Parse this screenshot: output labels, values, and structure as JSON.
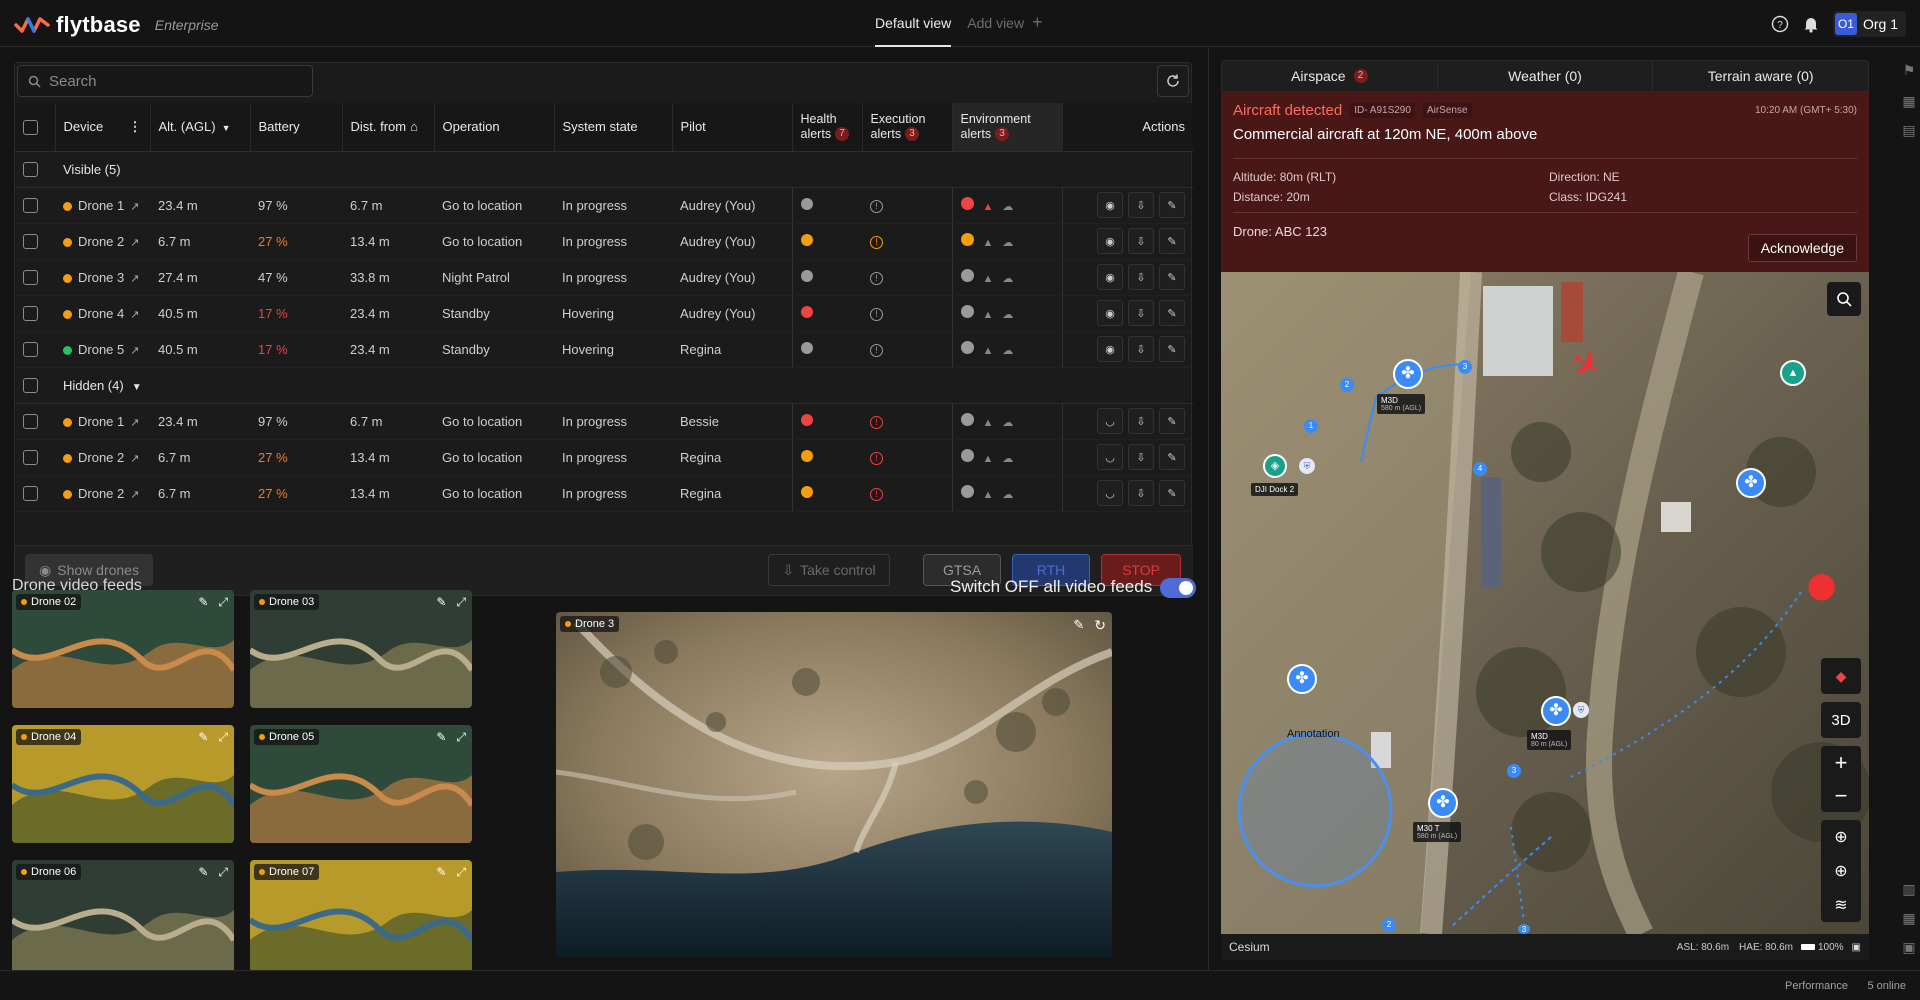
{
  "app": {
    "brand": "flytbase",
    "edition": "Enterprise"
  },
  "views": {
    "active": "Default view",
    "add": "Add view"
  },
  "org": {
    "badge": "O1",
    "name": "Org 1"
  },
  "table": {
    "search_placeholder": "Search",
    "columns": {
      "device": "Device",
      "alt": "Alt. (AGL)",
      "battery": "Battery",
      "dist": "Dist. from",
      "operation": "Operation",
      "system_state": "System state",
      "pilot": "Pilot",
      "health": "Health alerts",
      "health_count": "7",
      "execution": "Execution alerts",
      "execution_count": "3",
      "environment": "Environment alerts",
      "environment_count": "3",
      "actions": "Actions"
    },
    "visible_group": "Visible (5)",
    "hidden_group": "Hidden (4)",
    "visible_rows": [
      {
        "device": "Drone 1",
        "status": "warn",
        "alt": "23.4 m",
        "battery": "97 %",
        "battery_level": "ok",
        "dist": "6.7 m",
        "operation": "Go to location",
        "state": "In progress",
        "pilot": "Audrey (You)",
        "health": "normal",
        "exec": "normal",
        "env": "alert"
      },
      {
        "device": "Drone 2",
        "status": "warn",
        "alt": "6.7 m",
        "battery": "27 %",
        "battery_level": "warn",
        "dist": "13.4 m",
        "operation": "Go to location",
        "state": "In progress",
        "pilot": "Audrey (You)",
        "health": "warn",
        "exec": "warn",
        "env": "warn"
      },
      {
        "device": "Drone 3",
        "status": "warn",
        "alt": "27.4 m",
        "battery": "47 %",
        "battery_level": "ok",
        "dist": "33.8 m",
        "operation": "Night Patrol",
        "state": "In progress",
        "pilot": "Audrey (You)",
        "health": "normal",
        "exec": "normal",
        "env": "normal"
      },
      {
        "device": "Drone 4",
        "status": "warn",
        "alt": "40.5 m",
        "battery": "17 %",
        "battery_level": "crit",
        "dist": "23.4 m",
        "operation": "Standby",
        "state": "Hovering",
        "pilot": "Audrey (You)",
        "health": "crit",
        "exec": "normal",
        "env": "normal"
      },
      {
        "device": "Drone 5",
        "status": "ok",
        "alt": "40.5 m",
        "battery": "17 %",
        "battery_level": "crit",
        "dist": "23.4 m",
        "operation": "Standby",
        "state": "Hovering",
        "pilot": "Regina",
        "health": "normal",
        "exec": "normal",
        "env": "normal"
      }
    ],
    "hidden_rows": [
      {
        "device": "Drone 1",
        "status": "warn",
        "alt": "23.4 m",
        "battery": "97 %",
        "battery_level": "ok",
        "dist": "6.7 m",
        "operation": "Go to location",
        "state": "In progress",
        "pilot": "Bessie",
        "health": "crit",
        "exec": "crit",
        "env": "normal"
      },
      {
        "device": "Drone 2",
        "status": "warn",
        "alt": "6.7 m",
        "battery": "27 %",
        "battery_level": "warn",
        "dist": "13.4 m",
        "operation": "Go to location",
        "state": "In progress",
        "pilot": "Regina",
        "health": "warn",
        "exec": "crit",
        "env": "normal"
      },
      {
        "device": "Drone 2",
        "status": "warn",
        "alt": "6.7 m",
        "battery": "27 %",
        "battery_level": "warn",
        "dist": "13.4 m",
        "operation": "Go to location",
        "state": "In progress",
        "pilot": "Regina",
        "health": "warn",
        "exec": "crit",
        "env": "normal"
      }
    ],
    "buttons": {
      "show_drones": "Show drones",
      "take_control": "Take control",
      "gtsa": "GTSA",
      "rth": "RTH",
      "stop": "STOP"
    }
  },
  "feeds": {
    "title": "Drone video feeds",
    "switch_label": "Switch OFF all video feeds",
    "switch_on": true,
    "thumbs": [
      {
        "label": "Drone 02",
        "scene": "hills"
      },
      {
        "label": "Drone 03",
        "scene": "road"
      },
      {
        "label": "Drone 04",
        "scene": "river"
      },
      {
        "label": "Drone 05",
        "scene": "hills"
      },
      {
        "label": "Drone 06",
        "scene": "road"
      },
      {
        "label": "Drone 07",
        "scene": "river"
      }
    ],
    "main": {
      "label": "Drone 3"
    }
  },
  "panel": {
    "tabs": [
      {
        "label": "Airspace",
        "count": "2"
      },
      {
        "label": "Weather (0)"
      },
      {
        "label": "Terrain aware (0)"
      }
    ],
    "alert": {
      "title": "Aircraft detected",
      "id": "ID- A91S290",
      "source": "AirSense",
      "time": "10:20 AM (GMT+ 5:30)",
      "headline": "Commercial aircraft at 120m NE, 400m above",
      "altitude": "Altitude: 80m (RLT)",
      "direction": "Direction: NE",
      "distance": "Distance: 20m",
      "class": "Class: IDG241",
      "drone": "Drone: ABC 123",
      "ack": "Acknowledge"
    },
    "map": {
      "labels": {
        "m3d_top": "M3D",
        "m3d_top_alt": "580 m (AGL)",
        "dock": "DJI Dock 2",
        "m3d_mid": "M3D",
        "m3d_mid_alt": "80 m (AGL)",
        "m30t": "M30 T",
        "m30t_alt": "580 m (AGL)",
        "annotation": "Annotation"
      },
      "waypoints": [
        "1",
        "2",
        "3",
        "4",
        "3",
        "2",
        "3"
      ],
      "ctl_3d": "3D",
      "provider": "Cesium",
      "asl": "ASL: 80.6m",
      "hae": "HAE: 80.6m",
      "battery": "100%"
    }
  },
  "status": {
    "performance": "Performance",
    "online": "5 online"
  },
  "colors": {
    "accent": "#4f6bd8",
    "danger": "#ef4444",
    "warn": "#f59e0b",
    "ok": "#22c55e",
    "alert_bg": "#4a1717"
  }
}
